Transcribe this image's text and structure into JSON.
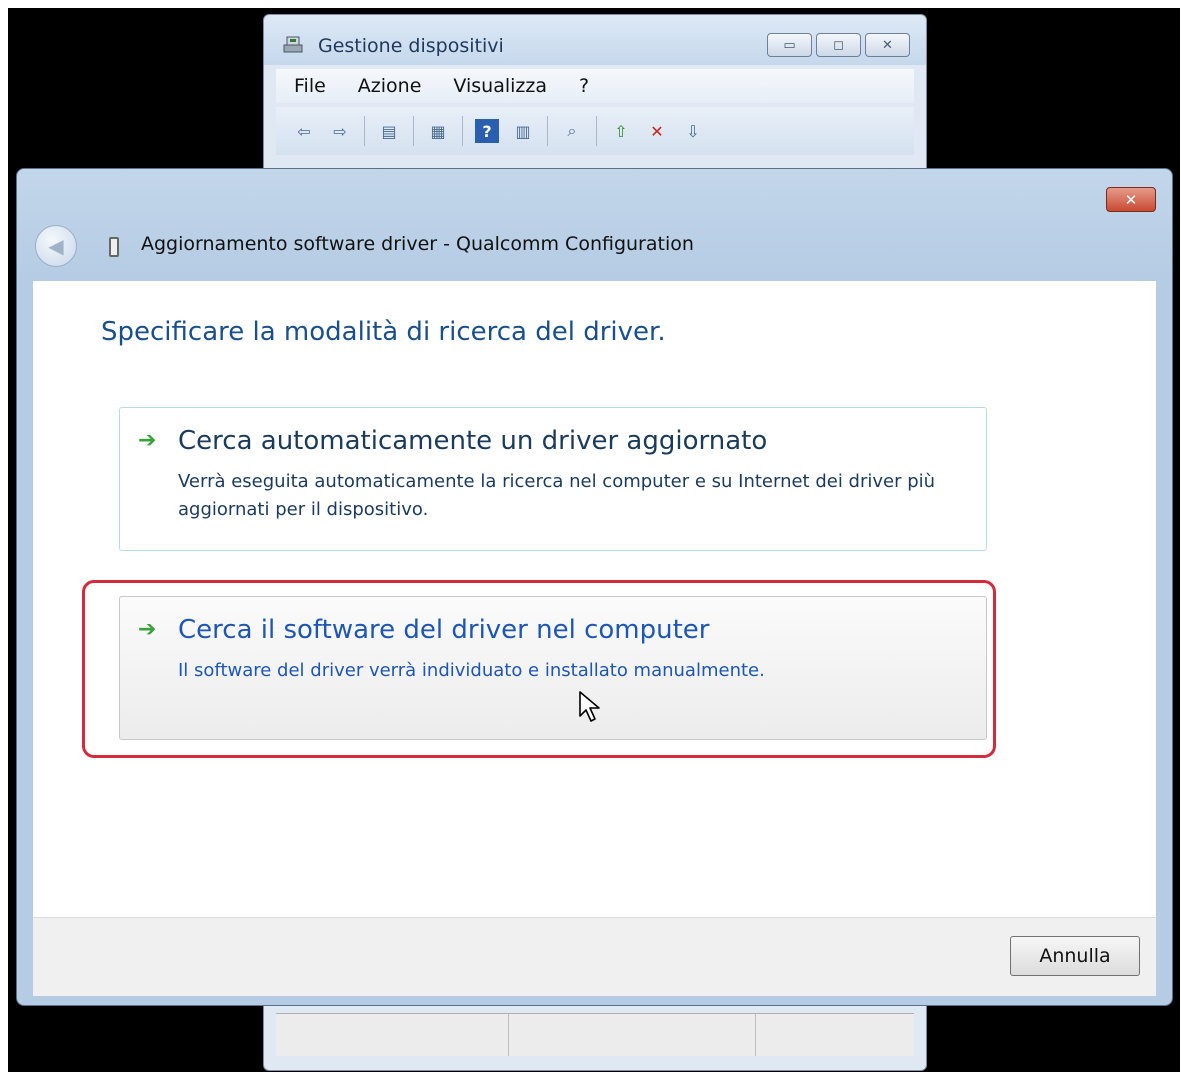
{
  "bg_window": {
    "title": "Gestione dispositivi",
    "menu": [
      "File",
      "Azione",
      "Visualizza",
      "?"
    ],
    "toolbar_icons": [
      "back-arrow-icon",
      "forward-arrow-icon",
      "show-hide-console-tree-icon",
      "properties-icon",
      "help-icon",
      "action-pane-icon",
      "scan-hardware-icon",
      "update-driver-icon",
      "uninstall-device-icon",
      "disable-device-icon"
    ]
  },
  "dialog": {
    "title": "Aggiornamento software driver - Qualcomm Configuration",
    "heading": "Specificare la modalità di ricerca del driver.",
    "option1": {
      "title": "Cerca automaticamente un driver aggiornato",
      "description": "Verrà eseguita automaticamente la ricerca nel computer e su Internet dei driver più aggiornati per il dispositivo."
    },
    "option2": {
      "title": "Cerca il software del driver nel computer",
      "description": "Il software del driver verrà individuato e installato manualmente."
    },
    "cancel_label": "Annulla"
  }
}
